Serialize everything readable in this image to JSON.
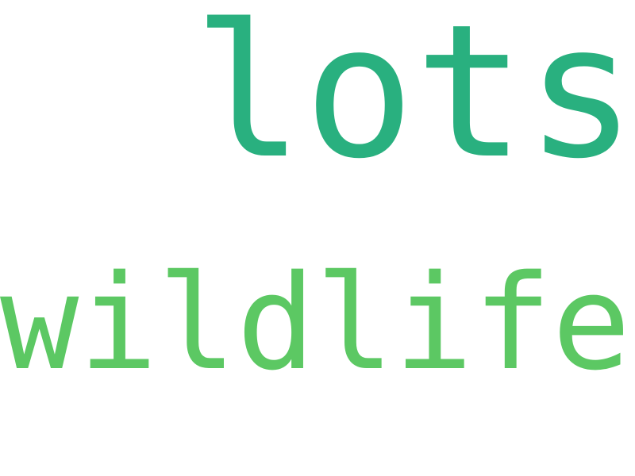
{
  "words": [
    {
      "text": "lots",
      "color": "#29b07f"
    },
    {
      "text": "wildlife",
      "color": "#5cc863"
    }
  ]
}
